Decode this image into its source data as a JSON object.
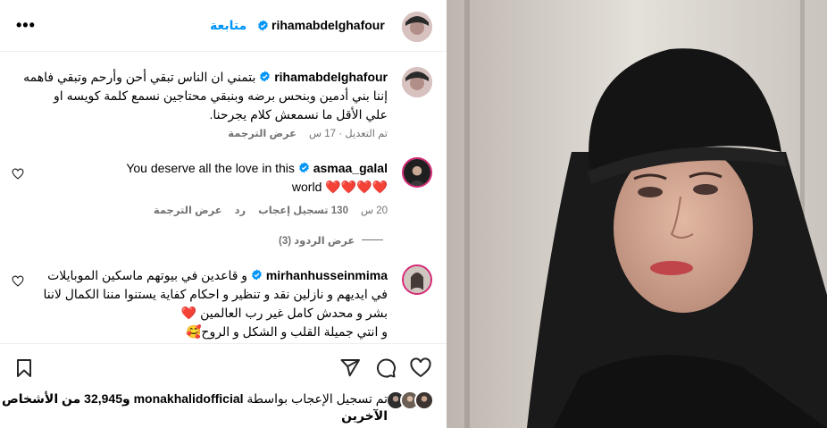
{
  "header": {
    "username": "rihamabdelghafour",
    "follow_label": "متابعة",
    "more_label": "•••"
  },
  "comments": {
    "caption": {
      "username": "rihamabdelghafour",
      "lines": [
        "بتمني ان الناس تبقي أحن وأرحم وتبقي فاهمه",
        "إننا بني أدمين وبنحس برضه وبنبقي محتاجين نسمع كلمة كويسه او",
        "علي الأقل ما نسمعش كلام يجرحنا."
      ],
      "edited": "تم التعديل · 17 س",
      "translate": "عرض الترجمة"
    },
    "c1": {
      "username": "asmaa_galal",
      "text_line1": "You deserve all the love in this",
      "text_line2": "world",
      "hearts": "❤️❤️❤️❤️",
      "time": "20 س",
      "likes": "130 تسجيل إعجاب",
      "reply": "رد",
      "translate": "عرض الترجمة",
      "view_replies": "عرض الردود (3)"
    },
    "c2": {
      "username": "mirhanhusseinmima",
      "line1": "و قاعدين في بيوتهم ماسكين الموبايلات",
      "line2": "في ايديهم و نازلين نقد و تنظير و احكام كفاية يستنوا مننا الكمال لاننا",
      "line3": "بشر و محدش كامل غير رب العالمين ❤️",
      "line4": "و انتي جميلة القلب و الشكل و الروح🥰"
    }
  },
  "likes": {
    "prefix": "تم تسجيل الإعجاب بواسطة",
    "user": "monakhalidofficial",
    "suffix": "و32,945 من الأشخاص الآخرين"
  },
  "icons": {
    "save": "bookmark-icon",
    "share": "send-icon",
    "comment": "comment-icon",
    "like": "heart-icon"
  },
  "colors": {
    "link_blue": "#0095f6",
    "verified_blue": "#0095f6",
    "muted": "#737373"
  }
}
